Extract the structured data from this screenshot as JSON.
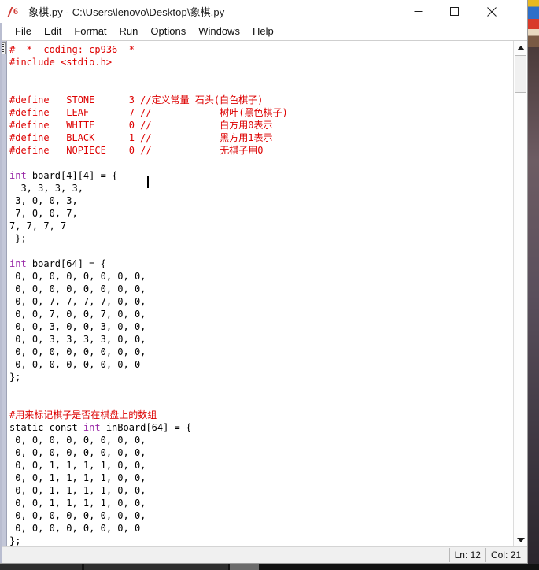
{
  "window": {
    "icon": "python-idle-icon",
    "title": "象棋.py - C:\\Users\\lenovo\\Desktop\\象棋.py",
    "controls": {
      "minimize": "minimize-button",
      "maximize": "maximize-button",
      "close": "close-button"
    }
  },
  "menubar": {
    "items": [
      {
        "label": "File"
      },
      {
        "label": "Edit"
      },
      {
        "label": "Format"
      },
      {
        "label": "Run"
      },
      {
        "label": "Options"
      },
      {
        "label": "Windows"
      },
      {
        "label": "Help"
      }
    ]
  },
  "editor": {
    "lines": [
      {
        "n": 1,
        "segs": [
          {
            "t": "# -*- coding: cp936 -*-",
            "c": "cm"
          }
        ]
      },
      {
        "n": 2,
        "segs": [
          {
            "t": "#include <stdio.h>",
            "c": "cm"
          }
        ]
      },
      {
        "n": 3,
        "segs": [
          {
            "t": "",
            "c": "pl"
          }
        ]
      },
      {
        "n": 4,
        "segs": [
          {
            "t": "",
            "c": "pl"
          }
        ]
      },
      {
        "n": 5,
        "segs": [
          {
            "t": "#define   STONE      3 //定义常量 石头(白色棋子)",
            "c": "cm"
          }
        ]
      },
      {
        "n": 6,
        "segs": [
          {
            "t": "#define   LEAF       7 //            树叶(黑色棋子)",
            "c": "cm"
          }
        ]
      },
      {
        "n": 7,
        "segs": [
          {
            "t": "#define   WHITE      0 //            白方用0表示",
            "c": "cm"
          }
        ]
      },
      {
        "n": 8,
        "segs": [
          {
            "t": "#define   BLACK      1 //            黑方用1表示",
            "c": "cm"
          }
        ]
      },
      {
        "n": 9,
        "segs": [
          {
            "t": "#define   NOPIECE    0 //            无棋子用0",
            "c": "cm"
          }
        ]
      },
      {
        "n": 10,
        "segs": [
          {
            "t": "",
            "c": "pl"
          }
        ]
      },
      {
        "n": 11,
        "segs": [
          {
            "t": "int",
            "c": "kw"
          },
          {
            "t": " board[4][4] = {",
            "c": "pl"
          }
        ]
      },
      {
        "n": 12,
        "segs": [
          {
            "t": "  3, 3, 3, 3,",
            "c": "pl"
          }
        ]
      },
      {
        "n": 13,
        "segs": [
          {
            "t": " 3, 0, 0, 3,",
            "c": "pl"
          }
        ]
      },
      {
        "n": 14,
        "segs": [
          {
            "t": " 7, 0, 0, 7,",
            "c": "pl"
          }
        ]
      },
      {
        "n": 15,
        "segs": [
          {
            "t": "7, 7, 7, 7",
            "c": "pl"
          }
        ]
      },
      {
        "n": 16,
        "segs": [
          {
            "t": " };",
            "c": "pl"
          }
        ]
      },
      {
        "n": 17,
        "segs": [
          {
            "t": "",
            "c": "pl"
          }
        ]
      },
      {
        "n": 18,
        "segs": [
          {
            "t": "int",
            "c": "kw"
          },
          {
            "t": " board[64] = {",
            "c": "pl"
          }
        ]
      },
      {
        "n": 19,
        "segs": [
          {
            "t": " 0, 0, 0, 0, 0, 0, 0, 0,",
            "c": "pl"
          }
        ]
      },
      {
        "n": 20,
        "segs": [
          {
            "t": " 0, 0, 0, 0, 0, 0, 0, 0,",
            "c": "pl"
          }
        ]
      },
      {
        "n": 21,
        "segs": [
          {
            "t": " 0, 0, 7, 7, 7, 7, 0, 0,",
            "c": "pl"
          }
        ]
      },
      {
        "n": 22,
        "segs": [
          {
            "t": " 0, 0, 7, 0, 0, 7, 0, 0,",
            "c": "pl"
          }
        ]
      },
      {
        "n": 23,
        "segs": [
          {
            "t": " 0, 0, 3, 0, 0, 3, 0, 0,",
            "c": "pl"
          }
        ]
      },
      {
        "n": 24,
        "segs": [
          {
            "t": " 0, 0, 3, 3, 3, 3, 0, 0,",
            "c": "pl"
          }
        ]
      },
      {
        "n": 25,
        "segs": [
          {
            "t": " 0, 0, 0, 0, 0, 0, 0, 0,",
            "c": "pl"
          }
        ]
      },
      {
        "n": 26,
        "segs": [
          {
            "t": " 0, 0, 0, 0, 0, 0, 0, 0",
            "c": "pl"
          }
        ]
      },
      {
        "n": 27,
        "segs": [
          {
            "t": "};",
            "c": "pl"
          }
        ]
      },
      {
        "n": 28,
        "segs": [
          {
            "t": "",
            "c": "pl"
          }
        ]
      },
      {
        "n": 29,
        "segs": [
          {
            "t": "",
            "c": "pl"
          }
        ]
      },
      {
        "n": 30,
        "segs": [
          {
            "t": "#用来标记棋子是否在棋盘上的数组",
            "c": "cm"
          }
        ]
      },
      {
        "n": 31,
        "segs": [
          {
            "t": "static const ",
            "c": "pl"
          },
          {
            "t": "int",
            "c": "kw"
          },
          {
            "t": " inBoard[64] = {",
            "c": "pl"
          }
        ]
      },
      {
        "n": 32,
        "segs": [
          {
            "t": " 0, 0, 0, 0, 0, 0, 0, 0,",
            "c": "pl"
          }
        ]
      },
      {
        "n": 33,
        "segs": [
          {
            "t": " 0, 0, 0, 0, 0, 0, 0, 0,",
            "c": "pl"
          }
        ]
      },
      {
        "n": 34,
        "segs": [
          {
            "t": " 0, 0, 1, 1, 1, 1, 0, 0,",
            "c": "pl"
          }
        ]
      },
      {
        "n": 35,
        "segs": [
          {
            "t": " 0, 0, 1, 1, 1, 1, 0, 0,",
            "c": "pl"
          }
        ]
      },
      {
        "n": 36,
        "segs": [
          {
            "t": " 0, 0, 1, 1, 1, 1, 0, 0,",
            "c": "pl"
          }
        ]
      },
      {
        "n": 37,
        "segs": [
          {
            "t": " 0, 0, 1, 1, 1, 1, 0, 0,",
            "c": "pl"
          }
        ]
      },
      {
        "n": 38,
        "segs": [
          {
            "t": " 0, 0, 0, 0, 0, 0, 0, 0,",
            "c": "pl"
          }
        ]
      },
      {
        "n": 39,
        "segs": [
          {
            "t": " 0, 0, 0, 0, 0, 0, 0, 0",
            "c": "pl"
          }
        ]
      },
      {
        "n": 40,
        "segs": [
          {
            "t": "};",
            "c": "pl"
          }
        ]
      }
    ],
    "caret": {
      "line": 12,
      "col": 21
    }
  },
  "statusbar": {
    "line_label": "Ln: 12",
    "col_label": "Col: 21"
  },
  "scrollbar": {
    "up_arrow": "scroll-up-arrow",
    "down_arrow": "scroll-down-arrow"
  },
  "colors": {
    "comment": "#dd0000",
    "keyword": "#9a2ba8",
    "plain": "#000000",
    "gutter": "#c3c7d8",
    "statusbar_bg": "#f0f0f0"
  }
}
